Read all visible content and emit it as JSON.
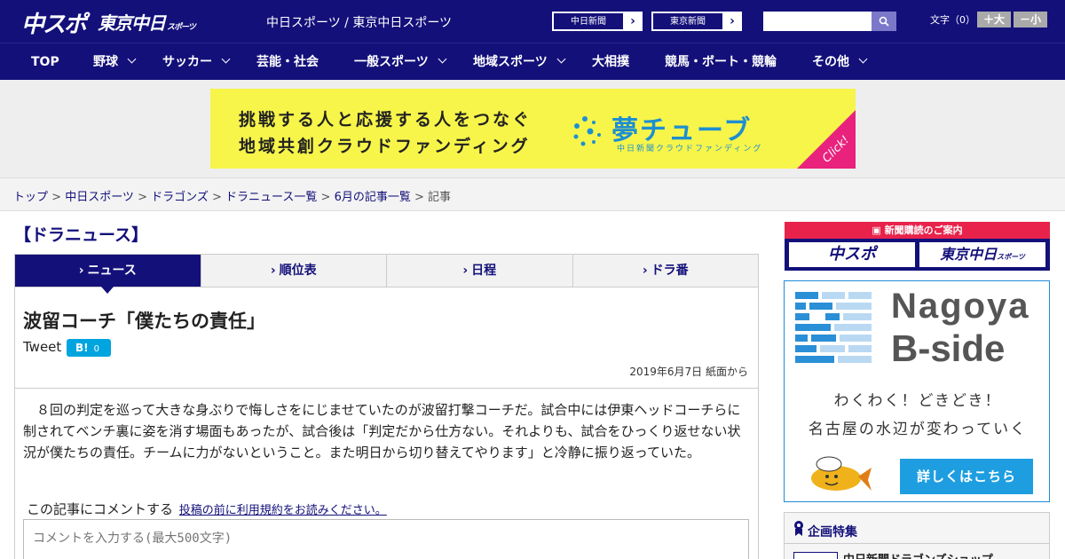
{
  "header": {
    "logo_primary": "中スポ",
    "logo_secondary": "東京中日",
    "logo_secondary_small": "スポーツ",
    "site_title": "中日スポーツ / 東京中日スポーツ",
    "paper_links": [
      "中日新聞",
      "東京新聞"
    ],
    "search_placeholder": "",
    "font_size_label": "文字（0）",
    "font_increase": "＋大",
    "font_decrease": "－小"
  },
  "nav": {
    "items": [
      {
        "label": "TOP",
        "has_menu": false
      },
      {
        "label": "野球",
        "has_menu": true
      },
      {
        "label": "サッカー",
        "has_menu": true
      },
      {
        "label": "芸能・社会",
        "has_menu": false
      },
      {
        "label": "一般スポーツ",
        "has_menu": true
      },
      {
        "label": "地域スポーツ",
        "has_menu": true
      },
      {
        "label": "大相撲",
        "has_menu": false
      },
      {
        "label": "競馬・ボート・競輪",
        "has_menu": false
      },
      {
        "label": "その他",
        "has_menu": true
      }
    ]
  },
  "banner": {
    "line1": "挑戦する人と応援する人をつなぐ",
    "line2": "地域共創クラウドファンディング",
    "brand": "夢チューブ",
    "brand_sub": "中日新聞クラウドファンディング",
    "click": "Click!"
  },
  "breadcrumb": {
    "items": [
      "トップ",
      "中日スポーツ",
      "ドラゴンズ",
      "ドラニュース一覧",
      "6月の記事一覧"
    ],
    "current": "記事"
  },
  "section": {
    "heading": "【ドラニュース】",
    "tabs": [
      {
        "label": "ニュース",
        "active": true
      },
      {
        "label": "順位表",
        "active": false
      },
      {
        "label": "日程",
        "active": false
      },
      {
        "label": "ドラ番",
        "active": false
      }
    ]
  },
  "article": {
    "headline": "波留コーチ「僕たちの責任」",
    "tweet": "Tweet",
    "hatena_label": "B!",
    "hatena_count": "0",
    "date": "2019年6月7日 紙面から",
    "body": "　８回の判定を巡って大きな身ぶりで悔しさをにじませていたのが波留打撃コーチだ。試合中には伊東ヘッドコーチらに制されてベンチ裏に姿を消す場面もあったが、試合後は「判定だから仕方ない。それよりも、試合をひっくり返せない状況が僕たちの責任。チームに力がないということ。また明日から切り替えてやります」と冷静に振り返っていた。",
    "comment_label": "この記事にコメントする",
    "comment_terms_link": "投稿の前に利用規約をお読みください。",
    "comment_placeholder": "コメントを入力する(最大500文字)"
  },
  "sidebar": {
    "subscribe_header": "新聞購読のご案内",
    "subscribe_logos": [
      "中スポ",
      "東京中日"
    ],
    "subscribe_logo_small": "スポーツ",
    "bside_title1": "Nagoya",
    "bside_title2": "B-side",
    "bside_line1": "わくわく！どきどき！",
    "bside_line2": "名古屋の水辺が変わっていく",
    "bside_button": "詳しくはこちら",
    "feature_heading": "企画特集",
    "feature_item": "中日新聞ドラゴンズショップ"
  },
  "colors": {
    "brand_navy": "#13107a",
    "banner_yellow": "#f7f54a",
    "accent_blue": "#1e9ee0",
    "subscribe_red": "#e8224a"
  }
}
